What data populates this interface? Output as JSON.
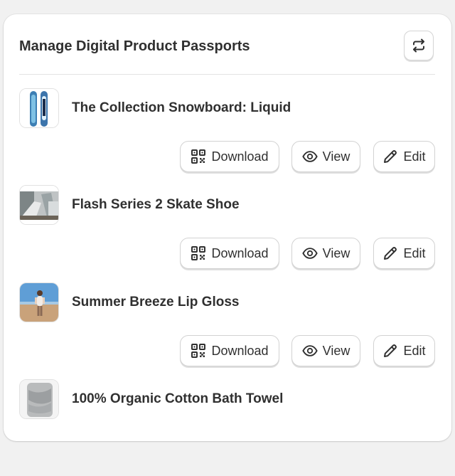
{
  "header": {
    "title": "Manage Digital Product Passports",
    "refresh_icon": "refresh-arrows-icon"
  },
  "products": [
    {
      "name": "The Collection Snowboard: Liquid",
      "image": "snowboard-image"
    },
    {
      "name": "Flash Series 2 Skate Shoe",
      "image": "skate-shoe-image"
    },
    {
      "name": "Summer Breeze Lip Gloss",
      "image": "lip-gloss-image"
    },
    {
      "name": "100% Organic Cotton Bath Towel",
      "image": "bath-towel-image"
    }
  ],
  "actions": {
    "download_label": "Download",
    "view_label": "View",
    "edit_label": "Edit",
    "download_icon": "qr-code-icon",
    "view_icon": "eye-icon",
    "edit_icon": "pencil-icon"
  },
  "colors": {
    "background": "#f1f1f1",
    "card": "#ffffff",
    "text": "#303030",
    "border": "#d2d2d2"
  }
}
